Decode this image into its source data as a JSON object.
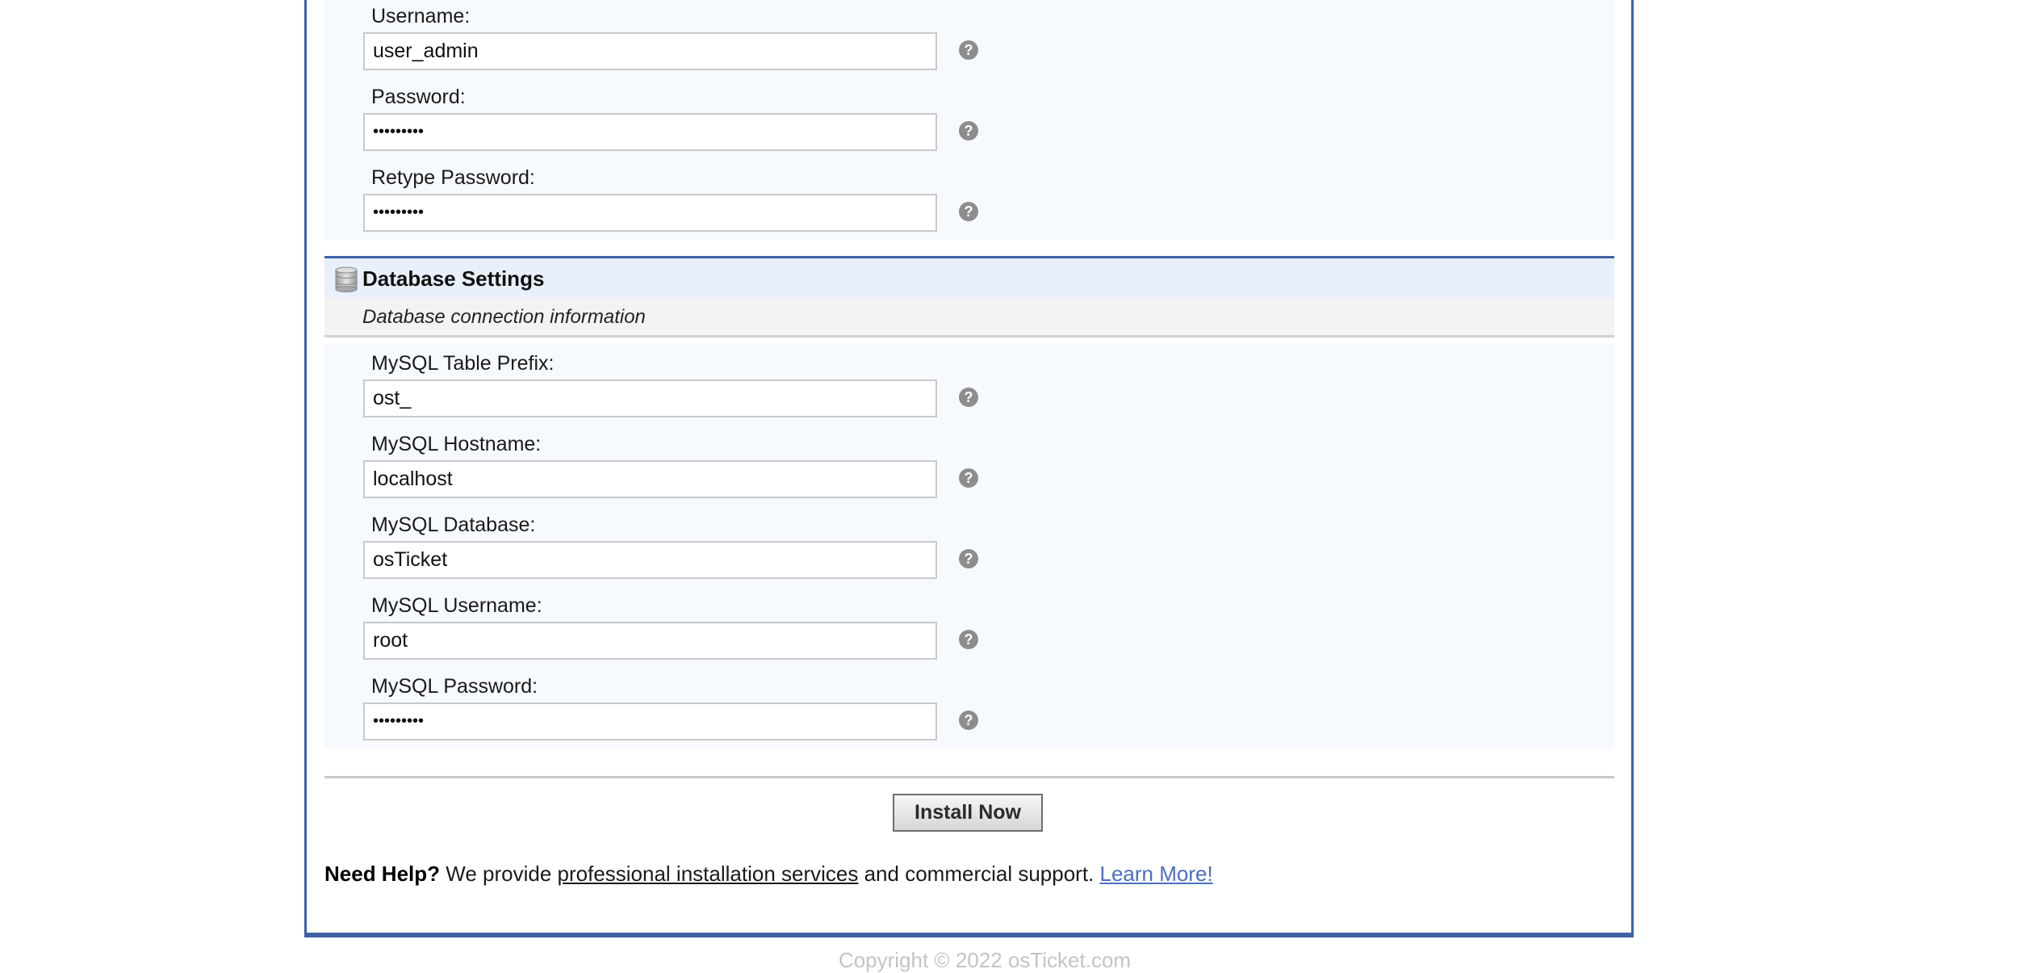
{
  "admin_section": {
    "fields": [
      {
        "label": "Username:",
        "value": "user_admin",
        "type": "text",
        "help_icon": "question-circle-icon"
      },
      {
        "label": "Password:",
        "value": "•••••••••",
        "type": "password",
        "help_icon": "question-circle-icon"
      },
      {
        "label": "Retype Password:",
        "value": "•••••••••",
        "type": "password",
        "help_icon": "question-circle-icon"
      }
    ]
  },
  "db_section": {
    "icon": "database-icon",
    "title": "Database Settings",
    "subtitle": "Database connection information",
    "fields": [
      {
        "label": "MySQL Table Prefix:",
        "value": "ost_",
        "type": "text",
        "help_icon": "question-circle-icon"
      },
      {
        "label": "MySQL Hostname:",
        "value": "localhost",
        "type": "text",
        "help_icon": "question-circle-icon"
      },
      {
        "label": "MySQL Database:",
        "value": "osTicket",
        "type": "text",
        "help_icon": "question-circle-icon"
      },
      {
        "label": "MySQL Username:",
        "value": "root",
        "type": "text",
        "help_icon": "question-circle-icon"
      },
      {
        "label": "MySQL Password:",
        "value": "•••••••••",
        "type": "password",
        "help_icon": "question-circle-icon"
      }
    ]
  },
  "actions": {
    "install_label": "Install Now"
  },
  "help": {
    "lead": "Need Help?",
    "text1": " We provide ",
    "link1": "professional installation services",
    "text2": " and commercial support. ",
    "link2": "Learn More!"
  },
  "footer": {
    "copyright": "Copyright © 2022 osTicket.com"
  },
  "colors": {
    "accent_border": "#3d62a8",
    "link": "#4a6fc0",
    "field_bg": "#f6f9fd",
    "header_bg": "#e8f0fb"
  }
}
